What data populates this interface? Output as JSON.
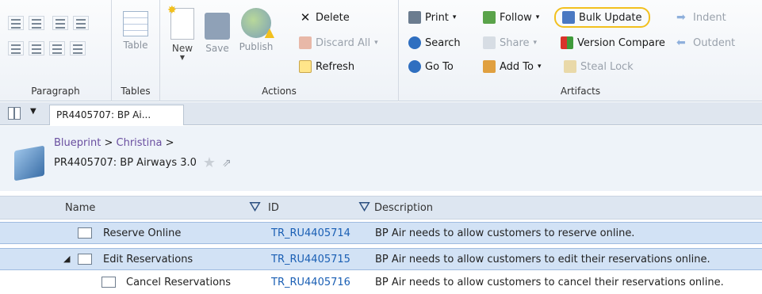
{
  "ribbon": {
    "groups": {
      "paragraph": "Paragraph",
      "tables": "Tables",
      "actions": "Actions",
      "artifacts": "Artifacts"
    },
    "tables_button": "Table",
    "actions": {
      "new": "New",
      "save": "Save",
      "publish": "Publish",
      "delete": "Delete",
      "discard_all": "Discard All",
      "refresh": "Refresh"
    },
    "artifacts": {
      "print": "Print",
      "follow": "Follow",
      "bulk_update": "Bulk Update",
      "indent": "Indent",
      "search": "Search",
      "share": "Share",
      "version_compare": "Version Compare",
      "outdent": "Outdent",
      "go_to": "Go To",
      "add_to": "Add To",
      "steal_lock": "Steal Lock"
    }
  },
  "tab": {
    "title": "PR4405707: BP Ai..."
  },
  "breadcrumb": {
    "root": "Blueprint",
    "child": "Christina",
    "sep": ">"
  },
  "artifact_title": "PR4405707: BP Airways 3.0",
  "table": {
    "columns": {
      "name": "Name",
      "id": "ID",
      "description": "Description"
    },
    "rows": [
      {
        "name": "Reserve Online",
        "id": "TR_RU4405714",
        "description": "BP Air needs to allow customers to reserve online."
      },
      {
        "name": "Edit Reservations",
        "id": "TR_RU4405715",
        "description": "BP Air needs to allow customers to edit their reservations online."
      },
      {
        "name": "Cancel Reservations",
        "id": "TR_RU4405716",
        "description": "BP Air needs to allow customers to cancel their reservations online."
      }
    ]
  },
  "colors": {
    "highlight": "#f2c01e",
    "link": "#1a5fb4",
    "selected_row": "#d2e2f5"
  }
}
